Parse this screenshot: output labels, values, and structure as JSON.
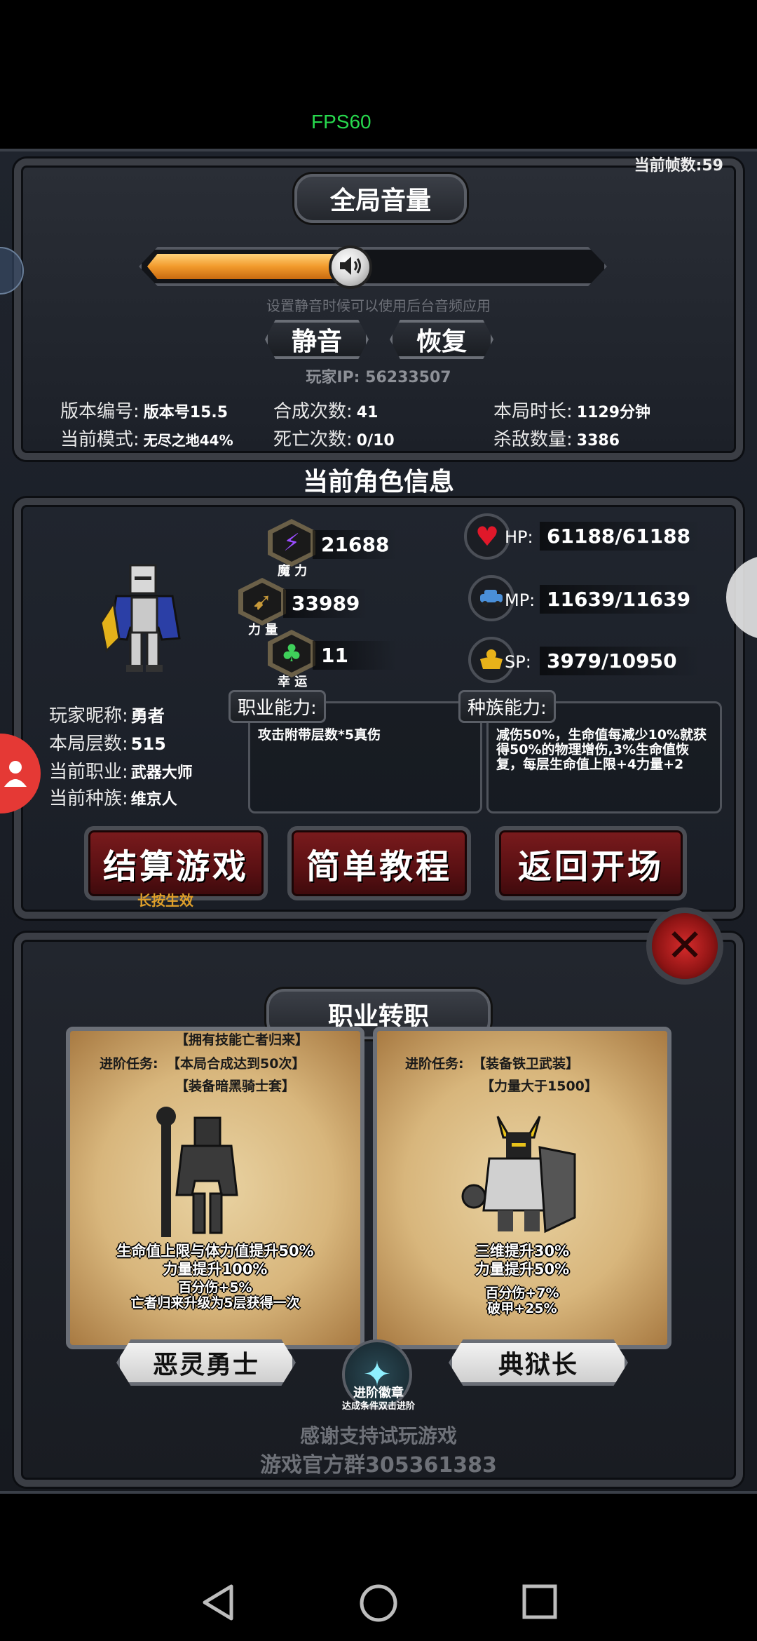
{
  "status": {
    "fps": "FPS60",
    "frame_counter": "当前帧数:59"
  },
  "volume": {
    "title": "全局音量",
    "level": 0.45,
    "hint": "设置静音时候可以使用后台音频应用",
    "mute_label": "静音",
    "restore_label": "恢复",
    "player_ip": "玩家IP:  56233507"
  },
  "stats": {
    "version_label": "版本编号:",
    "version_value": "版本号15.5",
    "mode_label": "当前模式:",
    "mode_value": "无尽之地44%",
    "synth_label": "合成次数:",
    "synth_value": "41",
    "death_label": "死亡次数:",
    "death_value": "0/10",
    "duration_label": "本局时长:",
    "duration_value": "1129分钟",
    "kills_label": "杀敌数量:",
    "kills_value": "3386"
  },
  "character": {
    "section_title": "当前角色信息",
    "magic_value": "21688",
    "magic_label": "魔 力",
    "power_value": "33989",
    "power_label": "力 量",
    "luck_value": "11",
    "luck_label": "幸 运",
    "hp_label": "HP:",
    "hp_value": "61188/61188",
    "mp_label": "MP:",
    "mp_value": "11639/11639",
    "sp_label": "SP:",
    "sp_value": "3979/10950",
    "nickname_label": "玩家昵称:",
    "nickname_value": "勇者",
    "floor_label": "本局层数:",
    "floor_value": "515",
    "job_label": "当前职业:",
    "job_value": "武器大师",
    "race_label": "当前种族:",
    "race_value": "维京人",
    "job_ability_title": "职业能力:",
    "job_ability_text": "攻击附带层数*5真伤",
    "race_ability_title": "种族能力:",
    "race_ability_text": "减伤50%，生命值每减少10%就获得50%的物理增伤,3%生命值恢复，每层生命值上限+4力量+2"
  },
  "actions": {
    "settle_label": "结算游戏",
    "settle_hint": "长按生效",
    "tutorial_label": "简单教程",
    "return_label": "返回开场"
  },
  "job_change": {
    "title": "职业转职",
    "left": {
      "req_top": "【拥有技能亡者归来】",
      "req_label": "进阶任务:",
      "req_1": "【本局合成达到50次】",
      "req_2": "【装备暗黑骑士套】",
      "effect_1": "生命值上限与体力值提升50%",
      "effect_2": "力量提升100%",
      "effect_3": "百分伤+5%",
      "effect_4": "亡者归来升级为5层获得一次",
      "name": "恶灵勇士"
    },
    "right": {
      "req_label": "进阶任务:",
      "req_1": "【装备铁卫武装】",
      "req_2": "【力量大于1500】",
      "effect_1": "三维提升30%",
      "effect_2": "力量提升50%",
      "effect_3": "百分伤+7%",
      "effect_4": "破甲+25%",
      "name": "典狱长"
    },
    "badge_label": "进阶徽章",
    "badge_hint": "达成条件双击进阶"
  },
  "footer": {
    "thanks": "感谢支持试玩游戏",
    "group": "游戏官方群305361383"
  },
  "icons": {
    "magic": "lightning-icon",
    "power": "bow-icon",
    "luck": "clover-icon",
    "hp": "heart-icon",
    "mp": "car-icon",
    "sp": "muscle-icon",
    "close": "close-icon",
    "nav_back": "back-triangle-icon",
    "nav_home": "home-circle-icon",
    "nav_recent": "recent-square-icon"
  },
  "colors": {
    "accent_orange": "#f29a2c",
    "fps_green": "#27d84d",
    "danger_red": "#d62b2b",
    "hint_gold": "#e0a02a"
  }
}
